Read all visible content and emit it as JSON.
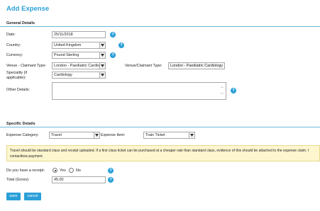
{
  "page": {
    "title": "Add Expense"
  },
  "general": {
    "heading": "General Details",
    "date": {
      "label": "Date:",
      "value": "25/11/2018"
    },
    "country": {
      "label": "Country:",
      "value": "United Kingdom"
    },
    "currency": {
      "label": "Currency:",
      "value": "Pound Sterling"
    },
    "venue_claimant": {
      "label": "Venue - Claimant Type:",
      "value": "London - Paediatric Cardio"
    },
    "venue_claimant_readonly": {
      "label": "Venue/Claimant Type:",
      "value": "London - Paediatric Cardiology"
    },
    "speciality": {
      "label_line1": "Speciality (if",
      "label_line2": "applicable):",
      "value": "Cardiology"
    },
    "other": {
      "label": "Other Details:",
      "value": ""
    }
  },
  "specific": {
    "heading": "Specific Details",
    "category": {
      "label": "Expense Category:",
      "value": "Travel"
    },
    "item": {
      "label": "Expense Item:",
      "value": "Train Ticket"
    },
    "info_text": "Travel should be standard class and receipt uploaded. If a first class ticket can be purchased at a cheaper rate than standard class, evidence of this should be attached to the expense claim. I contactless payment.",
    "receipt": {
      "label": "Do you have a receipt:",
      "yes": "Yes",
      "no": "No",
      "selected": "Yes"
    },
    "total": {
      "label": "Total (Gross):",
      "value": "45.00"
    }
  },
  "actions": {
    "save": "save",
    "cancel": "cancel"
  },
  "help_symbol": "?",
  "icons": {
    "help": "question-circle-icon",
    "dropdown": "chevron-down-icon"
  },
  "colors": {
    "accent": "#2a9fd8",
    "info_bg": "#fdf6cf"
  }
}
